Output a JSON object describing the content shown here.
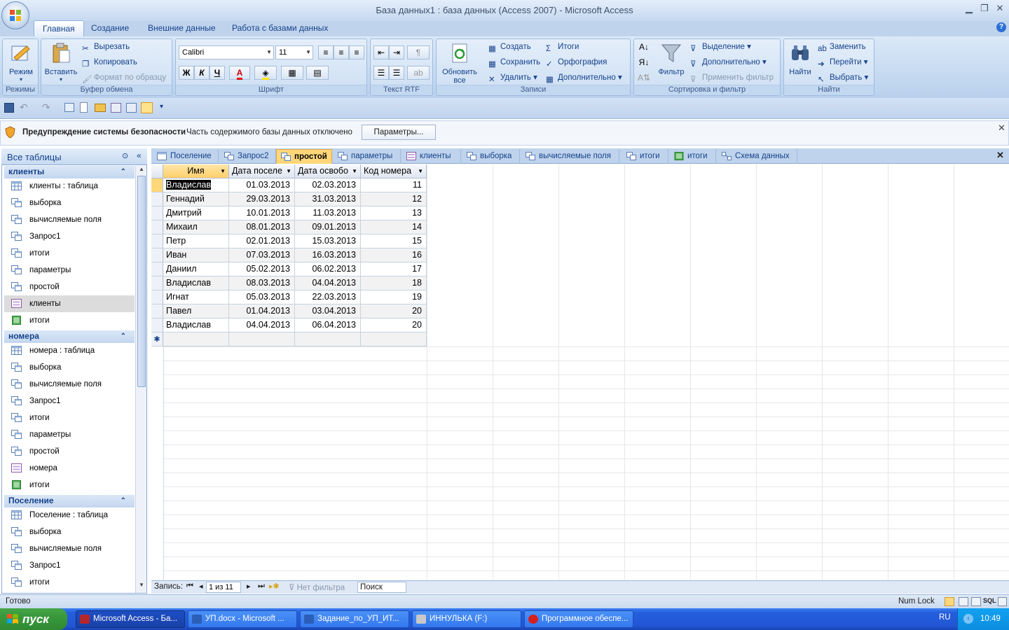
{
  "window": {
    "title": "База данных1 : база данных (Access 2007) - Microsoft Access"
  },
  "ribbon_tabs": [
    "Главная",
    "Создание",
    "Внешние данные",
    "Работа с базами данных"
  ],
  "ribbon": {
    "groups": {
      "modes": "Режимы",
      "clipboard": "Буфер обмена",
      "font": "Шрифт",
      "rtf": "Текст RTF",
      "records": "Записи",
      "sort_filter": "Сортировка и фильтр",
      "find": "Найти"
    },
    "mode_btn": "Режим",
    "paste_btn": "Вставить",
    "cut": "Вырезать",
    "copy": "Копировать",
    "format_painter": "Формат по образцу",
    "font_name": "Calibri",
    "font_size": "11",
    "bold": "Ж",
    "italic": "К",
    "underline": "Ч",
    "refresh_line1": "Обновить",
    "refresh_line2": "все",
    "new": "Создать",
    "save": "Сохранить",
    "delete": "Удалить",
    "totals": "Итоги",
    "spelling": "Орфография",
    "more": "Дополнительно",
    "filter": "Фильтр",
    "selection": "Выделение",
    "advanced": "Дополнительно",
    "apply_filter": "Применить фильтр",
    "find_btn": "Найти",
    "replace": "Заменить",
    "goto": "Перейти",
    "select": "Выбрать"
  },
  "security": {
    "title": "Предупреждение системы безопасности",
    "message": "Часть содержимого базы данных отключено",
    "button": "Параметры..."
  },
  "nav": {
    "header": "Все таблицы",
    "groups": [
      {
        "name": "клиенты",
        "items": [
          "клиенты : таблица",
          "выборка",
          "вычисляемые поля",
          "Запрос1",
          "итоги",
          "параметры",
          "простой",
          "клиенты",
          "итоги"
        ]
      },
      {
        "name": "номера",
        "items": [
          "номера : таблица",
          "выборка",
          "вычисляемые поля",
          "Запрос1",
          "итоги",
          "параметры",
          "простой",
          "номера",
          "итоги"
        ]
      },
      {
        "name": "Поселение",
        "items": [
          "Поселение : таблица",
          "выборка",
          "вычисляемые поля",
          "Запрос1",
          "итоги"
        ]
      }
    ]
  },
  "doc_tabs": [
    "Поселение",
    "Запрос2",
    "простой",
    "параметры",
    "клиенты",
    "выборка",
    "вычисляемые поля",
    "итоги",
    "итоги",
    "Схема данных"
  ],
  "grid": {
    "columns": [
      "Имя",
      "Дата поселе",
      "Дата освобо",
      "Код номера"
    ],
    "rows": [
      [
        "Владислав",
        "01.03.2013",
        "02.03.2013",
        "11"
      ],
      [
        "Геннадий",
        "29.03.2013",
        "31.03.2013",
        "12"
      ],
      [
        "Дмитрий",
        "10.01.2013",
        "11.03.2013",
        "13"
      ],
      [
        "Михаил",
        "08.01.2013",
        "09.01.2013",
        "14"
      ],
      [
        "Петр",
        "02.01.2013",
        "15.03.2013",
        "15"
      ],
      [
        "Иван",
        "07.03.2013",
        "16.03.2013",
        "16"
      ],
      [
        "Даниил",
        "05.02.2013",
        "06.02.2013",
        "17"
      ],
      [
        "Владислав",
        "08.03.2013",
        "04.04.2013",
        "18"
      ],
      [
        "Игнат",
        "05.03.2013",
        "22.03.2013",
        "19"
      ],
      [
        "Павел",
        "01.04.2013",
        "03.04.2013",
        "20"
      ],
      [
        "Владислав",
        "04.04.2013",
        "06.04.2013",
        "20"
      ]
    ],
    "new_row_marker": "✱"
  },
  "record_nav": {
    "label": "Запись:",
    "position": "1 из 11",
    "filter": "Нет фильтра",
    "search": "Поиск"
  },
  "status": {
    "left": "Готово",
    "numlock": "Num Lock",
    "sql": "SQL"
  },
  "taskbar": {
    "start": "пуск",
    "buttons": [
      "Microsoft Access - Ба...",
      "УП.docx - Microsoft ...",
      "Задание_по_УП_ИТ...",
      "ИННУЛЬКА (F:)",
      "Программное обеспе..."
    ],
    "lang": "RU",
    "time": "10:49"
  }
}
